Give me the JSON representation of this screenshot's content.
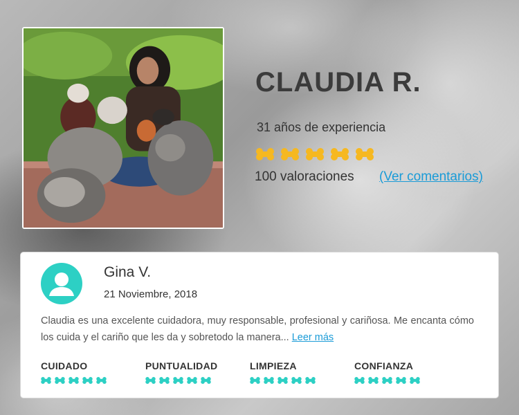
{
  "sitter": {
    "name": "CLAUDIA R.",
    "experience": "31 años de experiencia",
    "rating_bones": 5,
    "reviews_count": "100 valoraciones",
    "view_comments_label": "(Ver comentarios)"
  },
  "review": {
    "reviewer_name": "Gina V.",
    "date": "21 Noviembre, 2018",
    "text": "Claudia es una excelente cuidadora, muy responsable, profesional y cariñosa. Me encanta cómo los cuida y el cariño que les da y sobretodo la manera...",
    "read_more_label": "Leer más",
    "criteria": [
      {
        "label": "CUIDADO",
        "bones": 5
      },
      {
        "label": "PUNTUALIDAD",
        "bones": 5
      },
      {
        "label": "LIMPIEZA",
        "bones": 5
      },
      {
        "label": "CONFIANZA",
        "bones": 5
      }
    ]
  },
  "colors": {
    "rating_bone": "#f6b820",
    "criteria_bone": "#2dd0c4",
    "link": "#1a9bd7",
    "avatar_bg": "#2dd0c4"
  },
  "icons": {
    "rating": "bone-icon",
    "avatar": "user-icon"
  }
}
